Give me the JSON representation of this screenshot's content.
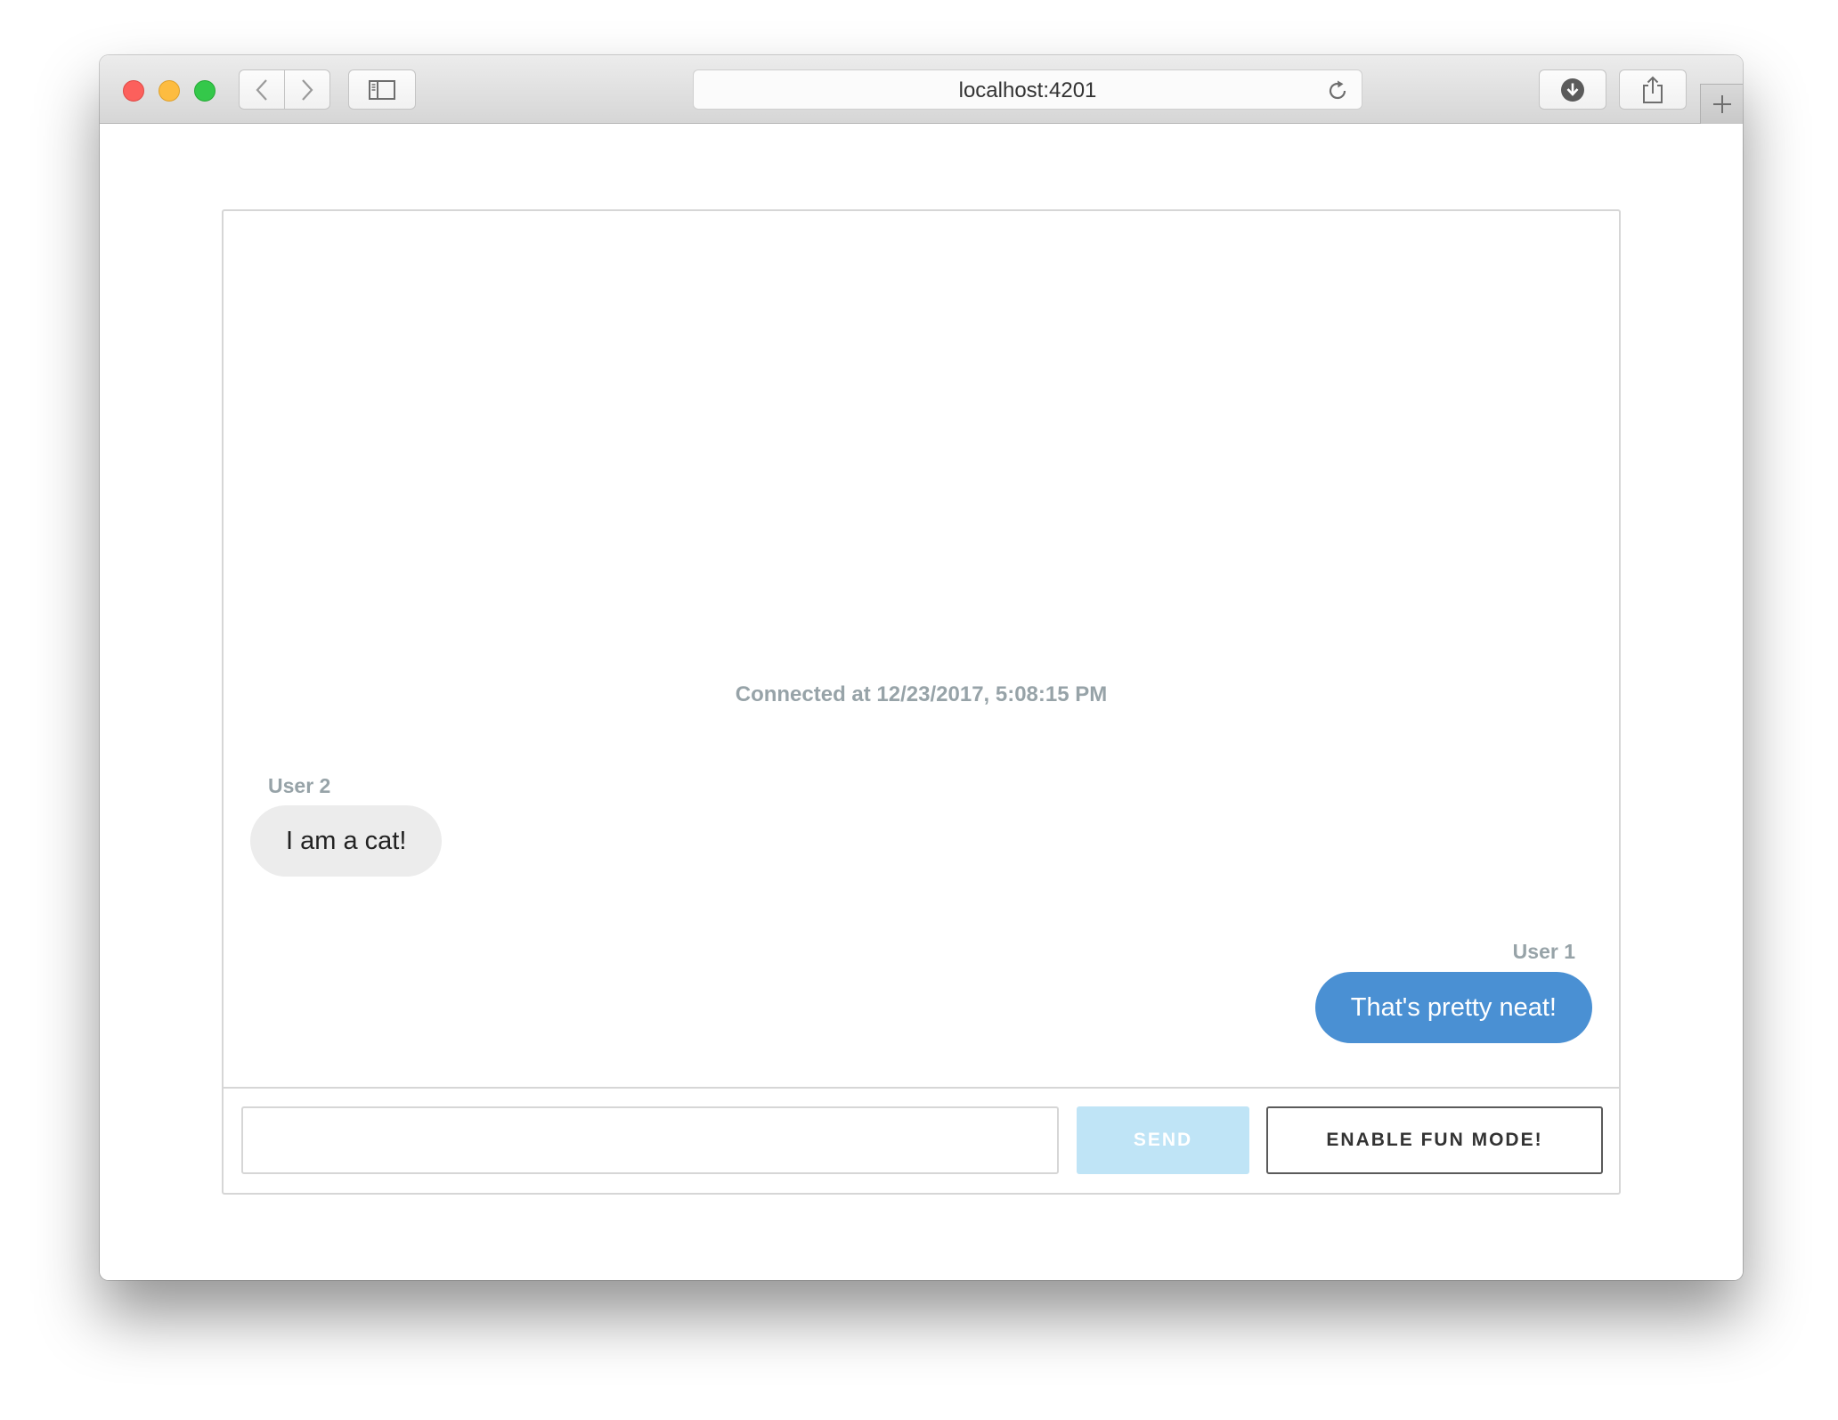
{
  "browser": {
    "url": "localhost:4201",
    "icons": {
      "close": "close-traffic-light",
      "minimize": "minimize-traffic-light",
      "maximize": "maximize-traffic-light",
      "back": "chevron-left-icon",
      "forward": "chevron-right-icon",
      "sidebar": "sidebar-icon",
      "reload": "reload-icon",
      "download": "download-icon",
      "share": "share-icon",
      "new_tab": "plus-icon"
    }
  },
  "chat": {
    "status": "Connected at 12/23/2017, 5:08:15 PM",
    "messages": [
      {
        "sender": "User 2",
        "text": "I am a cat!",
        "direction": "incoming"
      },
      {
        "sender": "User 1",
        "text": "That's pretty neat!",
        "direction": "outgoing"
      }
    ],
    "composer": {
      "input_value": "",
      "placeholder": "",
      "send_label": "SEND",
      "fun_mode_label": "ENABLE FUN MODE!"
    }
  },
  "colors": {
    "outgoing_bubble": "#4a90d3",
    "incoming_bubble": "#ececec",
    "send_button_disabled": "#bfe4f6",
    "meta_text": "#97a3a8"
  }
}
